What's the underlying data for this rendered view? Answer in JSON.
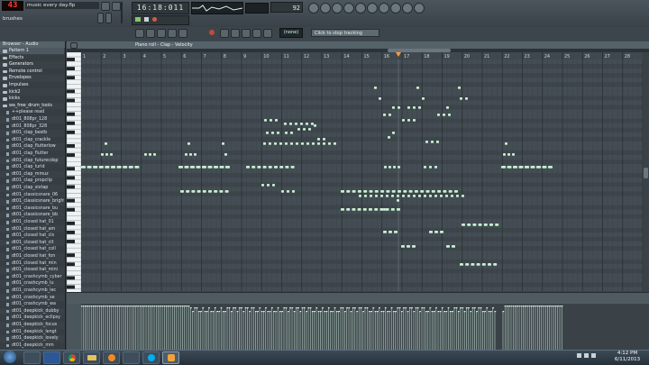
{
  "toolbar": {
    "cpu_counter": "43",
    "song_title": "music every day.flp",
    "hint_text": "brushes",
    "time_display": "16:18:011",
    "tempo_display": "92"
  },
  "toolbar2": {
    "pattern_value": "(none)",
    "hint_bar_text": "Click to stop tracking"
  },
  "browser": {
    "title": "Browser - Audio",
    "items": [
      {
        "label": "Pattern 1",
        "kind": "folder"
      },
      {
        "label": "Effects",
        "kind": "folder"
      },
      {
        "label": "Generators",
        "kind": "folder"
      },
      {
        "label": "Remote control",
        "kind": "folder"
      },
      {
        "label": "Envelopes",
        "kind": "folder"
      },
      {
        "label": "Impulses",
        "kind": "folder"
      },
      {
        "label": "kick2",
        "kind": "folder"
      },
      {
        "label": "kicks",
        "kind": "folder"
      },
      {
        "label": "wa_free_drum_tools",
        "kind": "folder"
      },
      {
        "label": "++please read",
        "kind": "file"
      },
      {
        "label": "dt01_808pr_128",
        "kind": "file"
      },
      {
        "label": "dt01_808pr_328",
        "kind": "file"
      },
      {
        "label": "dt01_clap_bestb",
        "kind": "file"
      },
      {
        "label": "dt01_clap_crackle",
        "kind": "file"
      },
      {
        "label": "dt01_clap_flutterlow",
        "kind": "file"
      },
      {
        "label": "dt01_clap_flutter",
        "kind": "file"
      },
      {
        "label": "dt01_clap_futurecdsp",
        "kind": "file"
      },
      {
        "label": "dt01_clap_lurid",
        "kind": "file"
      },
      {
        "label": "dt01_clap_mmuz",
        "kind": "file"
      },
      {
        "label": "dt01_clap_propclip",
        "kind": "file"
      },
      {
        "label": "dt01_clap_sixtap",
        "kind": "file"
      },
      {
        "label": "dt01_classicsnare_06",
        "kind": "file"
      },
      {
        "label": "dt01_classicsnare_bright",
        "kind": "file"
      },
      {
        "label": "dt01_classicsnare_bu",
        "kind": "file"
      },
      {
        "label": "dt01_classicsnare_bb",
        "kind": "file"
      },
      {
        "label": "dt01_closed hat_01",
        "kind": "file"
      },
      {
        "label": "dt01_closed hat_am",
        "kind": "file"
      },
      {
        "label": "dt01_closed hat_cls",
        "kind": "file"
      },
      {
        "label": "dt01_closed hat_clt",
        "kind": "file"
      },
      {
        "label": "dt01_closed hat_coll",
        "kind": "file"
      },
      {
        "label": "dt01_closed hat_fon",
        "kind": "file"
      },
      {
        "label": "dt01_closed hat_min",
        "kind": "file"
      },
      {
        "label": "dt01_closed hat_mini",
        "kind": "file"
      },
      {
        "label": "dt01_crashcymb_cyber",
        "kind": "file"
      },
      {
        "label": "dt01_crashcymb_lu",
        "kind": "file"
      },
      {
        "label": "dt01_crashcymb_lec",
        "kind": "file"
      },
      {
        "label": "dt01_crashcymb_se",
        "kind": "file"
      },
      {
        "label": "dt01_crashcymb_wa",
        "kind": "file"
      },
      {
        "label": "dt01_deepkick_dubby",
        "kind": "file"
      },
      {
        "label": "dt01_deepkick_eclipsy",
        "kind": "file"
      },
      {
        "label": "dt01_deepkick_focus",
        "kind": "file"
      },
      {
        "label": "dt01_deepkick_lengt",
        "kind": "file"
      },
      {
        "label": "dt01_deepkick_lovely",
        "kind": "file"
      },
      {
        "label": "dt01_deepkick_mm",
        "kind": "file"
      }
    ]
  },
  "pianoroll": {
    "title": "Piano roll - Clap - Velocity",
    "bar_numbers": [
      "1",
      "2",
      "3",
      "4",
      "5",
      "6",
      "7",
      "8",
      "9",
      "10",
      "11",
      "12",
      "13",
      "14",
      "15",
      "16",
      "17",
      "18",
      "19",
      "20",
      "21",
      "22",
      "23",
      "24",
      "25",
      "26",
      "27",
      "28"
    ]
  },
  "taskbar": {
    "apps": [
      "explorer",
      "word",
      "chrome",
      "folder",
      "media",
      "network",
      "skype",
      "fl-studio"
    ],
    "time": "4:12 PM",
    "date": "6/11/2013"
  },
  "colors": {
    "note": "#c8f0d0",
    "grid_bg": "#444d54",
    "playhead": "#ff9a3c",
    "cpu_text": "#ff3a2a"
  }
}
